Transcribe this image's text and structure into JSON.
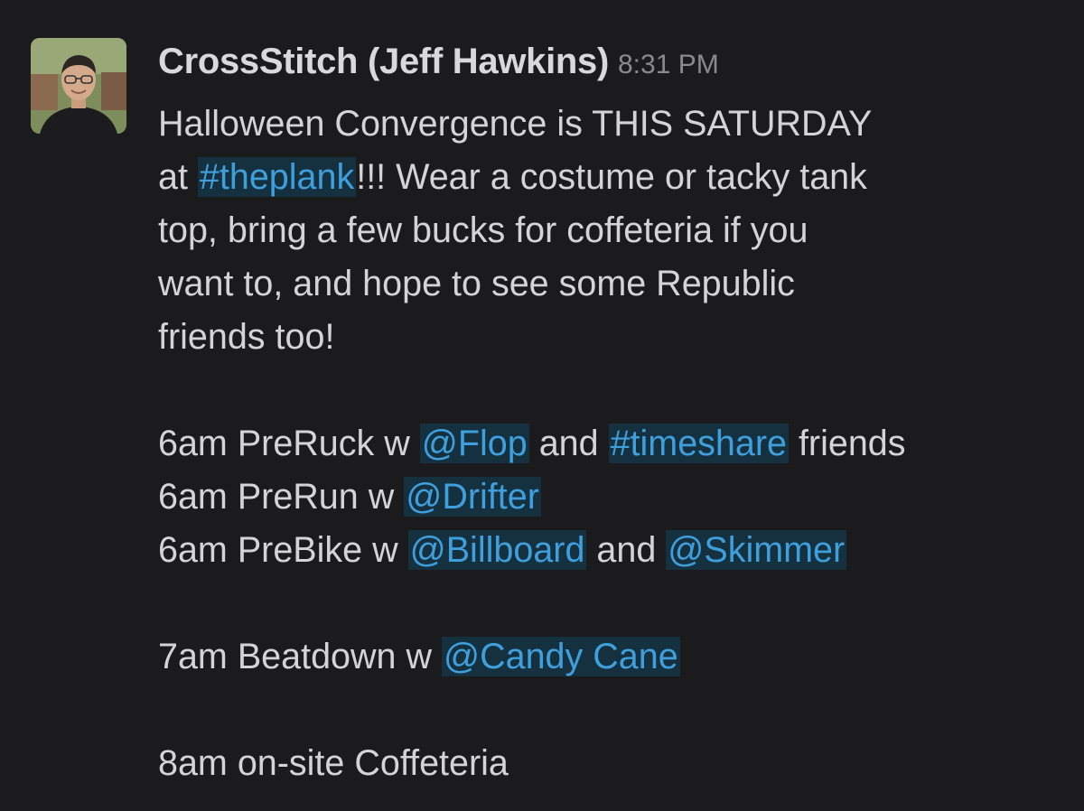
{
  "message": {
    "author": "CrossStitch (Jeff Hawkins)",
    "timestamp": "8:31 PM",
    "avatar_icon": "user-avatar-photo",
    "colors": {
      "background": "#1b1b1d",
      "text": "#d4d4d6",
      "link": "#3f9fdc",
      "link_bg": "#15313f",
      "timestamp": "#8a8a8d"
    },
    "line1": "Halloween Convergence is THIS SATURDAY",
    "line2_a": "at ",
    "line2_channel": "#theplank",
    "line2_b": "!!! Wear a costume or tacky tank",
    "line3": "top, bring a few bucks for coffeteria if you",
    "line4": "want to, and hope to see some Republic",
    "line5": "friends too!",
    "pre_ruck_a": "6am PreRuck w ",
    "pre_ruck_mention": "@Flop",
    "pre_ruck_b": " and ",
    "pre_ruck_channel": "#timeshare",
    "pre_ruck_c": " friends",
    "pre_run_a": "6am PreRun w ",
    "pre_run_mention": "@Drifter",
    "pre_bike_a": "6am PreBike w ",
    "pre_bike_mention1": "@Billboard",
    "pre_bike_b": " and ",
    "pre_bike_mention2": "@Skimmer",
    "beatdown_a": "7am Beatdown w ",
    "beatdown_mention": "@Candy Cane",
    "coffeteria": "8am on-site Coffeteria"
  }
}
